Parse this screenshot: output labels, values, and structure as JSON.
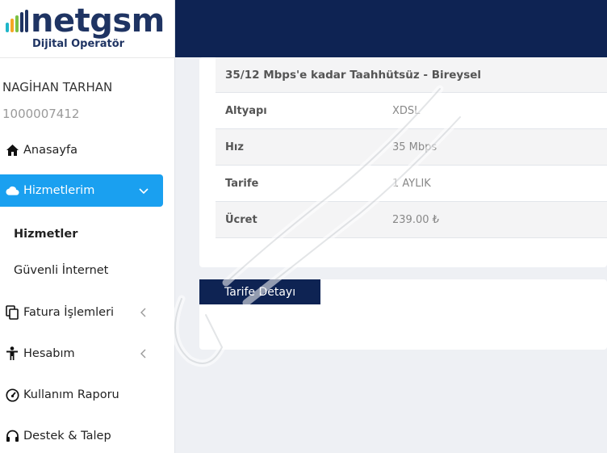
{
  "brand": {
    "logo_text": "netgsm",
    "subtitle": "Dijital Operatör",
    "colors": {
      "navy": "#1f3463",
      "bar_teal": "#1fb6c9",
      "bar_orange": "#f5a623",
      "bar_green": "#7ac142"
    }
  },
  "user": {
    "name": "NAGİHAN TARHAN",
    "id": "1000007412"
  },
  "sidebar": {
    "items": [
      {
        "label": "Anasayfa",
        "icon": "home-icon"
      },
      {
        "label": "Hizmetlerim",
        "icon": "cloud-icon",
        "active": true,
        "chevron": "chevron-down-icon"
      },
      {
        "label": "Fatura İşlemleri",
        "icon": "copy-icon",
        "chevron": "chevron-left-icon"
      },
      {
        "label": "Hesabım",
        "icon": "person-icon",
        "chevron": "chevron-left-icon"
      },
      {
        "label": "Kullanım Raporu",
        "icon": "gauge-icon"
      },
      {
        "label": "Destek & Talep",
        "icon": "headset-icon"
      }
    ],
    "subitems": [
      {
        "label": "Hizmetler",
        "active": true
      },
      {
        "label": "Güvenli İnternet"
      }
    ]
  },
  "service": {
    "title": "35/12 Mbps'e kadar Taahhütsüz - Bireysel",
    "rows": [
      {
        "label": "Altyapı",
        "value": "XDSL"
      },
      {
        "label": "Hız",
        "value": "35 Mbps"
      },
      {
        "label": "Tarife",
        "value": "1 AYLIK"
      },
      {
        "label": "Ücret",
        "value": "239.00 ₺"
      }
    ]
  },
  "actions": {
    "tariff_detail_label": "Tarife Detayı"
  },
  "colors": {
    "topbar": "#0e2353",
    "active_nav": "#1aa0f0",
    "page_bg": "#eef0f4"
  }
}
